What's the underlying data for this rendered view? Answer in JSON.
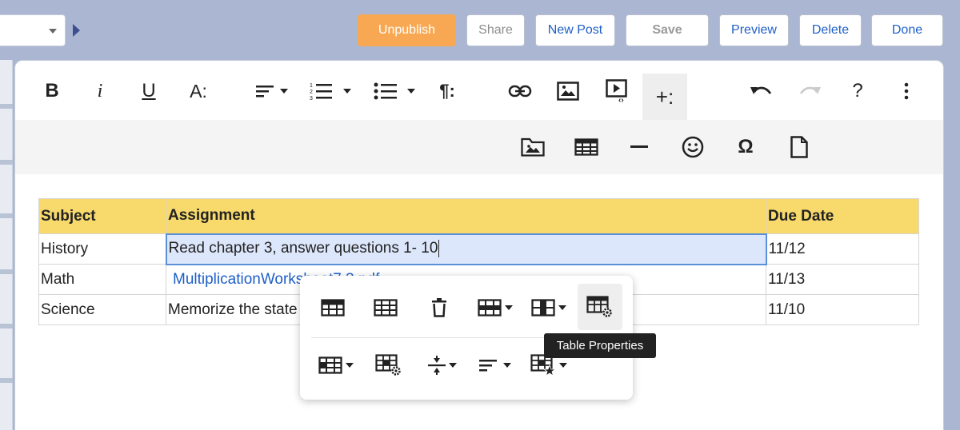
{
  "top_bar": {
    "buttons": {
      "unpublish": "Unpublish",
      "share": "Share",
      "new_post": "New Post",
      "save": "Save",
      "preview": "Preview",
      "delete": "Delete",
      "done": "Done"
    }
  },
  "toolbar": {
    "bold": "B",
    "italic": "i",
    "underline": "U",
    "font_size": "A:",
    "paragraph_format": "¶:",
    "more": "+:",
    "help": "?"
  },
  "subbar": {
    "special_chars": "Ω"
  },
  "table": {
    "headers": [
      "Subject",
      "Assignment",
      "Due Date"
    ],
    "rows": [
      [
        "History",
        "Read chapter 3, answer questions 1- 10",
        "11/12"
      ],
      [
        "Math",
        "MultiplicationWorksheet7.3.pdf",
        "11/13"
      ],
      [
        "Science",
        "Memorize the state capitals",
        "11/10"
      ]
    ]
  },
  "popup": {
    "tooltip": "Table Properties"
  },
  "colors": {
    "accent_orange": "#f8a853",
    "link_blue": "#1e5fc7",
    "header_yellow": "#f7d96c",
    "selected_cell": "#dde7fb",
    "background": "#aab6d2"
  }
}
